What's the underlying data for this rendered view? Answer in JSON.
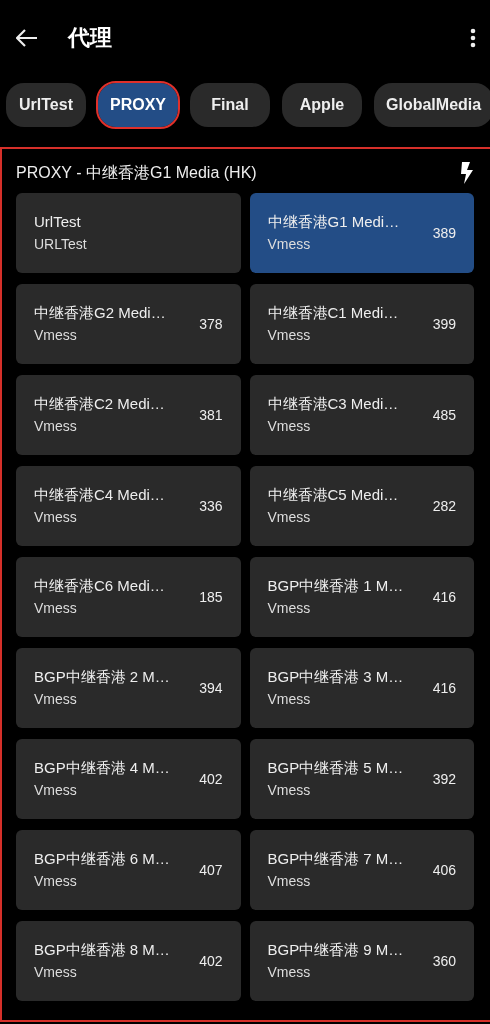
{
  "app_bar": {
    "title": "代理"
  },
  "tabs": [
    {
      "label": "UrlTest",
      "selected": false
    },
    {
      "label": "PROXY",
      "selected": true
    },
    {
      "label": "Final",
      "selected": false
    },
    {
      "label": "Apple",
      "selected": false
    },
    {
      "label": "GlobalMedia",
      "selected": false
    }
  ],
  "group": {
    "title": "PROXY - 中继香港G1 Media (HK)"
  },
  "proxies": [
    {
      "name": "UrlTest",
      "type": "URLTest",
      "selected": false
    },
    {
      "name": "中继香港G1 Medi…",
      "type": "Vmess",
      "delay": "389",
      "selected": true
    },
    {
      "name": "中继香港G2 Medi…",
      "type": "Vmess",
      "delay": "378",
      "selected": false
    },
    {
      "name": "中继香港C1 Medi…",
      "type": "Vmess",
      "delay": "399",
      "selected": false
    },
    {
      "name": "中继香港C2 Medi…",
      "type": "Vmess",
      "delay": "381",
      "selected": false
    },
    {
      "name": "中继香港C3 Medi…",
      "type": "Vmess",
      "delay": "485",
      "selected": false
    },
    {
      "name": "中继香港C4 Medi…",
      "type": "Vmess",
      "delay": "336",
      "selected": false
    },
    {
      "name": "中继香港C5 Medi…",
      "type": "Vmess",
      "delay": "282",
      "selected": false
    },
    {
      "name": "中继香港C6 Medi…",
      "type": "Vmess",
      "delay": "185",
      "selected": false
    },
    {
      "name": "BGP中继香港 1 M…",
      "type": "Vmess",
      "delay": "416",
      "selected": false
    },
    {
      "name": "BGP中继香港 2 M…",
      "type": "Vmess",
      "delay": "394",
      "selected": false
    },
    {
      "name": "BGP中继香港 3 M…",
      "type": "Vmess",
      "delay": "416",
      "selected": false
    },
    {
      "name": "BGP中继香港 4 M…",
      "type": "Vmess",
      "delay": "402",
      "selected": false
    },
    {
      "name": "BGP中继香港 5 M…",
      "type": "Vmess",
      "delay": "392",
      "selected": false
    },
    {
      "name": "BGP中继香港 6 M…",
      "type": "Vmess",
      "delay": "407",
      "selected": false
    },
    {
      "name": "BGP中继香港 7 M…",
      "type": "Vmess",
      "delay": "406",
      "selected": false
    },
    {
      "name": "BGP中继香港 8 M…",
      "type": "Vmess",
      "delay": "402",
      "selected": false
    },
    {
      "name": "BGP中继香港 9 M…",
      "type": "Vmess",
      "delay": "360",
      "selected": false
    }
  ]
}
